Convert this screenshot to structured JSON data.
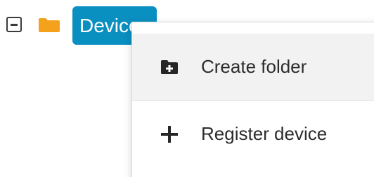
{
  "tree": {
    "node": {
      "label": "Devices",
      "toggle_icon": "collapse-minus-icon",
      "folder_icon": "folder-icon",
      "folder_color": "#f4a21d",
      "highlight_color": "#0a8fc1"
    }
  },
  "context_menu": {
    "items": [
      {
        "label": "Create folder",
        "icon": "folder-plus-icon"
      },
      {
        "label": "Register device",
        "icon": "plus-icon"
      }
    ]
  }
}
